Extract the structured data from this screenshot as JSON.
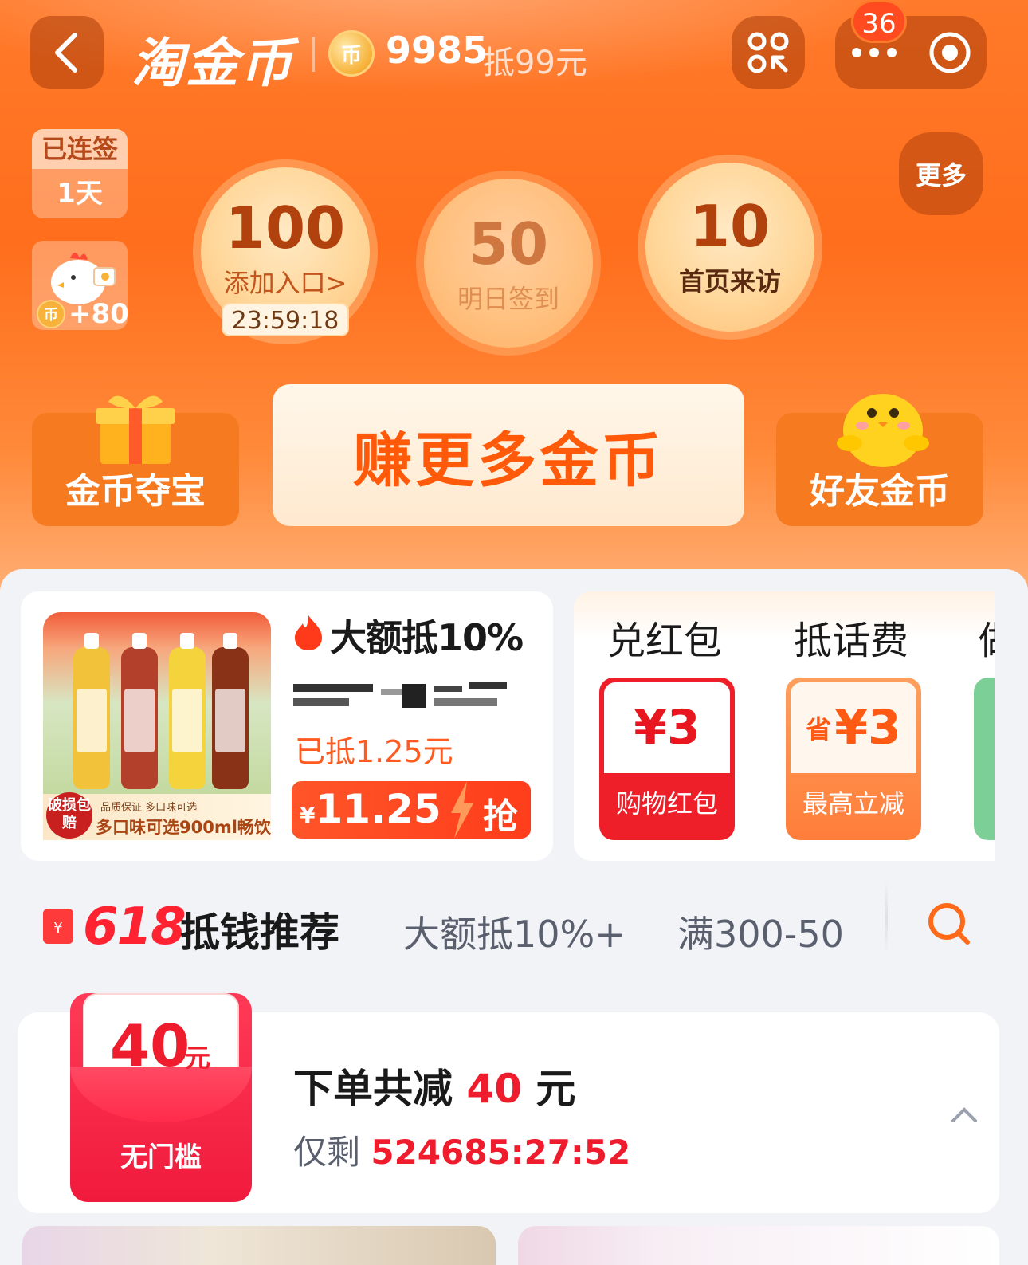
{
  "header": {
    "title": "淘金币",
    "coin_balance": "9985",
    "coin_worth": "抵99元",
    "coin_icon_glyph": "币",
    "message_badge": "36"
  },
  "sign_in": {
    "streak_label": "已连签",
    "streak_days": "1天",
    "bonus_amount": "+80",
    "more_label": "更多",
    "bubbles": [
      {
        "value": "100",
        "label": "添加入口>",
        "countdown": "23:59:18"
      },
      {
        "value": "50",
        "label": "明日签到"
      },
      {
        "value": "10",
        "label": "首页来访"
      }
    ]
  },
  "actions": {
    "treasure": "金币夺宝",
    "earn_more": "赚更多金币",
    "friends": "好友金币"
  },
  "deal": {
    "title": "大额抵10%",
    "deducted": "已抵1.25元",
    "price_symbol": "¥",
    "price": "11.25",
    "grab_label": "抢",
    "badge": "破损包赔",
    "quality_tag": "品质保证 多口味可选",
    "flavor_note": "多口味可选900ml畅饮"
  },
  "rewards": {
    "headers": [
      "兑红包",
      "抵话费",
      "做"
    ],
    "tiles": [
      {
        "value": "¥3",
        "label": "购物红包"
      },
      {
        "prefix": "省",
        "value": "¥3",
        "label": "最高立减"
      }
    ]
  },
  "recommend": {
    "badge_618": "618",
    "title": "抵钱推荐",
    "filters": [
      "大额抵10%+",
      "满300-50"
    ]
  },
  "coupon": {
    "value": "40",
    "unit": "元",
    "threshold": "无门槛",
    "title_prefix": "下单共减 ",
    "title_amount": "40",
    "title_suffix": " 元",
    "remain_prefix": "仅剩 ",
    "remain_timer": "524685:27:52"
  },
  "colors": {
    "brand_orange": "#ff6e1c",
    "accent_red": "#ee1c2c",
    "earn_text": "#ff5a0a"
  }
}
